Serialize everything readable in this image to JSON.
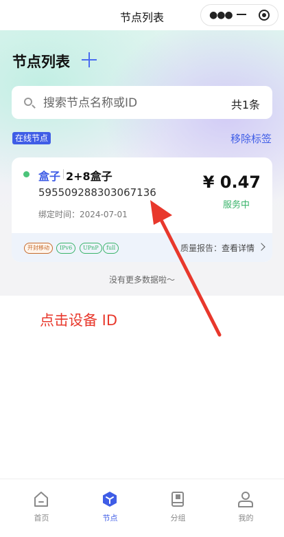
{
  "topbar": {
    "title": "节点列表"
  },
  "page": {
    "title": "节点列表"
  },
  "search": {
    "placeholder": "搜索节点名称或ID",
    "count": "共1条"
  },
  "section": {
    "tag": "在线节点",
    "remove_label": "移除标签"
  },
  "node": {
    "name": "盒子",
    "type": "2+8盒子",
    "id": "595509288303067136",
    "bind_time": "绑定时间：2024-07-01",
    "price": "¥ 0.47",
    "status": "服务中",
    "tags": [
      "开封移动",
      "IPv6",
      "UPnP",
      "full"
    ],
    "report_label": "质量报告：",
    "report_link": "查看详情"
  },
  "list_end": "没有更多数据啦～",
  "annotation": "点击设备 ID",
  "colors": {
    "accent": "#3f5de6",
    "online": "#4cc47a",
    "annotation": "#e8382c"
  },
  "tabbar": {
    "items": [
      {
        "label": "首页",
        "icon": "home-icon"
      },
      {
        "label": "节点",
        "icon": "node-cube-icon"
      },
      {
        "label": "分组",
        "icon": "group-book-icon"
      },
      {
        "label": "我的",
        "icon": "user-icon"
      }
    ],
    "active": "节点"
  }
}
